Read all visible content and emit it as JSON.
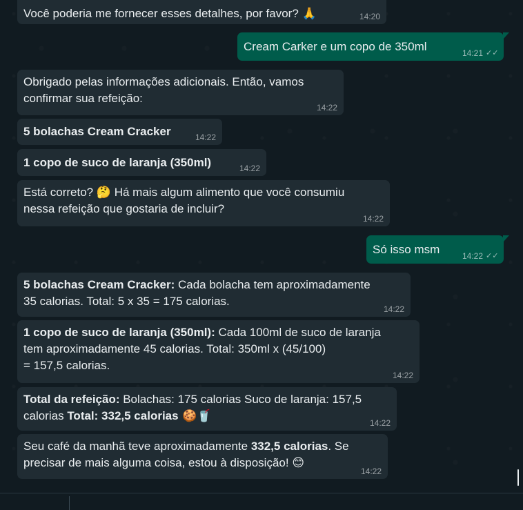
{
  "messages": [
    {
      "text": "Você poderia me fornecer esses detalhes, por favor? 🙏",
      "time": "14:20",
      "dir": "in"
    },
    {
      "text": "Cream Carker e um copo de 350ml",
      "time": "14:21",
      "dir": "out"
    },
    {
      "line1": "Obrigado pelas informações adicionais. Então, vamos",
      "line2": "confirmar sua refeição:",
      "time": "14:22",
      "dir": "in"
    },
    {
      "bold": "5 bolachas Cream Cracker",
      "time": "14:22",
      "dir": "in"
    },
    {
      "bold": "1 copo de suco de laranja (350ml)",
      "time": "14:22",
      "dir": "in"
    },
    {
      "line1_a": "Está correto? ",
      "emoji": "🤔",
      "line1_b": " Há mais algum alimento que você consumiu",
      "line2": "nessa refeição que gostaria de incluir?",
      "time": "14:22",
      "dir": "in"
    },
    {
      "text": "Só isso msm",
      "time": "14:22",
      "dir": "out"
    },
    {
      "bold": "5 bolachas Cream Cracker:",
      "line1": " Cada bolacha tem aproximadamente",
      "line2": "35 calorias. Total: 5 x 35 = 175 calorias.",
      "time": "14:22",
      "dir": "in"
    },
    {
      "bold": "1 copo de suco de laranja (350ml):",
      "line1": " Cada 100ml de suco de laranja",
      "line2": "tem aproximadamente 45 calorias. Total: 350ml x (45/100)",
      "line3": "= 157,5 calorias.",
      "time": "14:22",
      "dir": "in"
    },
    {
      "bold1": "Total da refeição:",
      "line1": " Bolachas: 175 calorias Suco de laranja: 157,5",
      "line2_a": "calorias ",
      "bold2": "Total: 332,5 calorias",
      "emoji": " 🍪🥤",
      "time": "14:22",
      "dir": "in"
    },
    {
      "line1_a": "Seu café da manhã teve aproximadamente ",
      "bold": "332,5 calorias",
      "line1_b": ". Se",
      "line2": "precisar de mais alguma coisa, estou à disposição! ",
      "emoji": "😊",
      "time": "14:22",
      "dir": "in"
    }
  ],
  "icons": {
    "double_check": "double-check-icon"
  },
  "colors": {
    "incoming": "#202c33",
    "outgoing": "#005c4b",
    "background": "#111b21",
    "text": "#e9edef"
  }
}
